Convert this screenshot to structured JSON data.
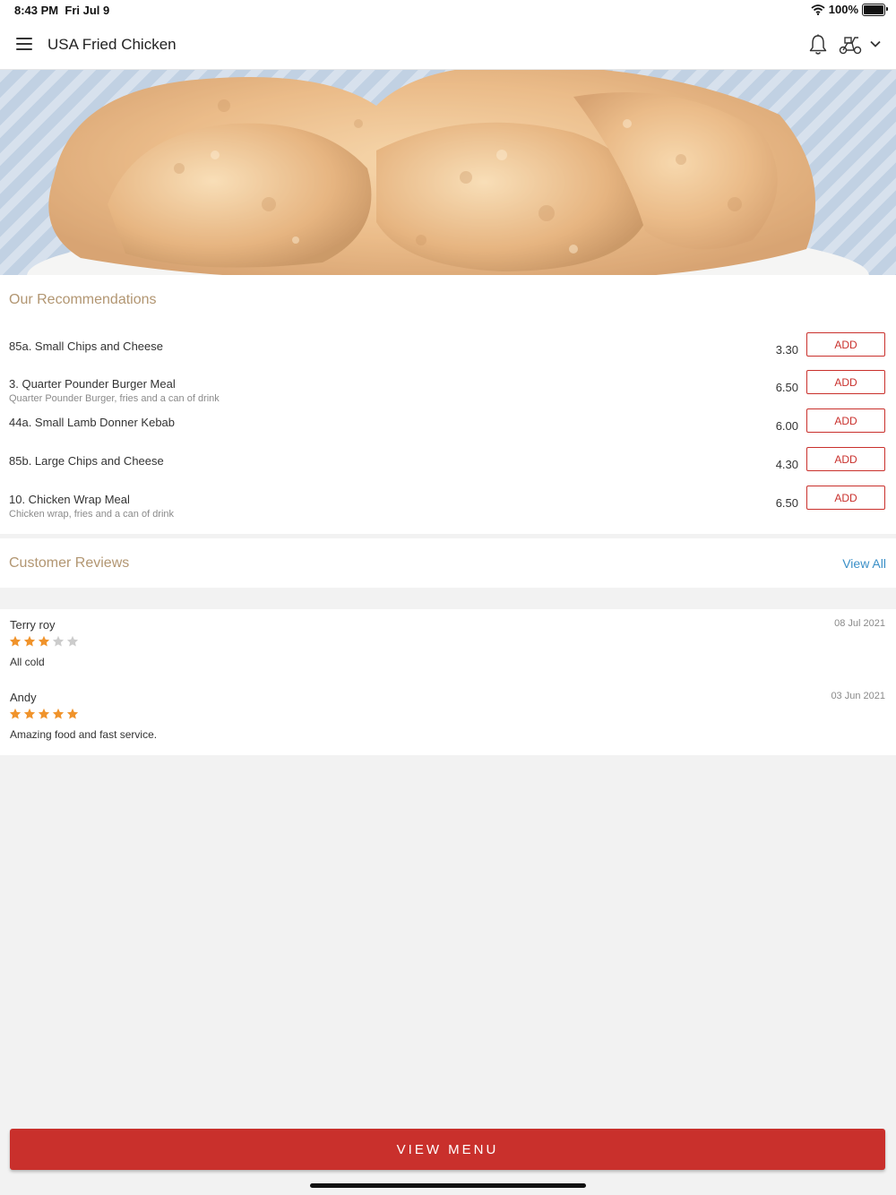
{
  "status": {
    "time": "8:43 PM",
    "date": "Fri Jul 9",
    "battery": "100%",
    "wifi_icon": "wifi-icon",
    "battery_icon": "battery-icon"
  },
  "header": {
    "title": "USA Fried Chicken",
    "icons": [
      "menu-icon",
      "bell-icon",
      "scooter-icon",
      "chevron-down-icon"
    ]
  },
  "hero": {
    "image": "fried-chicken-photo"
  },
  "recommendations": {
    "title": "Our Recommendations",
    "add_label": "ADD",
    "items": [
      {
        "name": "85a. Small Chips and Cheese",
        "description": "",
        "price": "3.30"
      },
      {
        "name": "3. Quarter Pounder Burger Meal",
        "description": "Quarter Pounder Burger, fries and a can of drink",
        "price": "6.50"
      },
      {
        "name": "44a. Small Lamb Donner Kebab",
        "description": "",
        "price": "6.00"
      },
      {
        "name": "85b. Large Chips and Cheese",
        "description": "",
        "price": "4.30"
      },
      {
        "name": "10. Chicken Wrap Meal",
        "description": "Chicken wrap, fries and a can of drink",
        "price": "6.50"
      }
    ]
  },
  "reviews": {
    "title": "Customer Reviews",
    "view_all": "View All",
    "items": [
      {
        "name": "Terry roy",
        "date": "08 Jul 2021",
        "rating": 3,
        "max_rating": 5,
        "text": "All cold"
      },
      {
        "name": "Andy",
        "date": "03 Jun 2021",
        "rating": 5,
        "max_rating": 5,
        "text": "Amazing food and fast service."
      }
    ]
  },
  "footer": {
    "view_menu": "VIEW MENU"
  },
  "colors": {
    "accent": "#c9302c",
    "section_title": "#b29672",
    "link": "#3a8fc7",
    "star_on": "#f0932b",
    "star_off": "#cccccc"
  }
}
